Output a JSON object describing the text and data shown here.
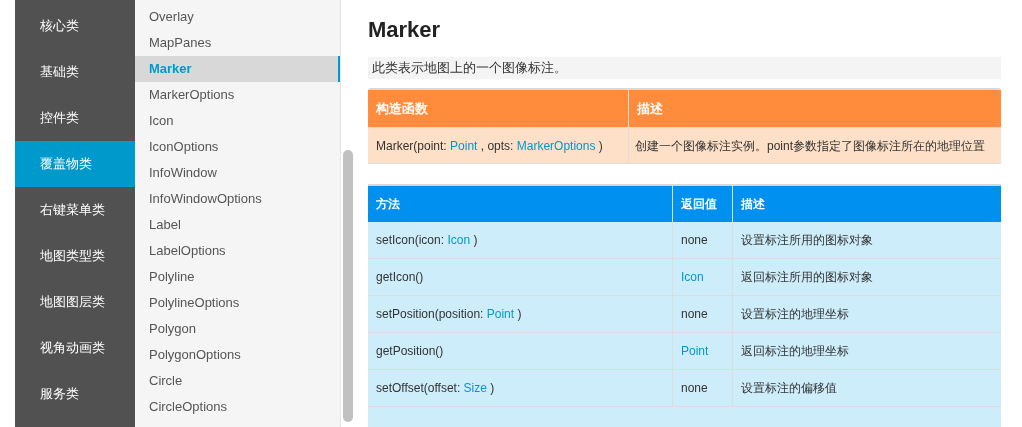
{
  "categories": [
    {
      "label": "核心类",
      "selected": false
    },
    {
      "label": "基础类",
      "selected": false
    },
    {
      "label": "控件类",
      "selected": false
    },
    {
      "label": "覆盖物类",
      "selected": true
    },
    {
      "label": "右键菜单类",
      "selected": false
    },
    {
      "label": "地图类型类",
      "selected": false
    },
    {
      "label": "地图图层类",
      "selected": false
    },
    {
      "label": "视角动画类",
      "selected": false
    },
    {
      "label": "服务类",
      "selected": false
    }
  ],
  "classes": [
    {
      "label": "Overlay",
      "selected": false
    },
    {
      "label": "MapPanes",
      "selected": false
    },
    {
      "label": "Marker",
      "selected": true
    },
    {
      "label": "MarkerOptions",
      "selected": false
    },
    {
      "label": "Icon",
      "selected": false
    },
    {
      "label": "IconOptions",
      "selected": false
    },
    {
      "label": "InfoWindow",
      "selected": false
    },
    {
      "label": "InfoWindowOptions",
      "selected": false
    },
    {
      "label": "Label",
      "selected": false
    },
    {
      "label": "LabelOptions",
      "selected": false
    },
    {
      "label": "Polyline",
      "selected": false
    },
    {
      "label": "PolylineOptions",
      "selected": false
    },
    {
      "label": "Polygon",
      "selected": false
    },
    {
      "label": "PolygonOptions",
      "selected": false
    },
    {
      "label": "Circle",
      "selected": false
    },
    {
      "label": "CircleOptions",
      "selected": false
    }
  ],
  "page": {
    "title": "Marker",
    "summary": "此类表示地图上的一个图像标注。"
  },
  "constructor_table": {
    "columns": [
      "构造函数",
      "描述"
    ],
    "rows": [
      {
        "signature": [
          {
            "kind": "code",
            "text": "Marker(point: "
          },
          {
            "kind": "link",
            "text": "Point"
          },
          {
            "kind": "code",
            "text": " , opts: "
          },
          {
            "kind": "link",
            "text": "MarkerOptions"
          },
          {
            "kind": "code",
            "text": " )"
          }
        ],
        "description": "创建一个图像标注实例。point参数指定了图像标注所在的地理位置"
      }
    ]
  },
  "method_table": {
    "columns": [
      "方法",
      "返回值",
      "描述"
    ],
    "rows": [
      {
        "method": [
          {
            "kind": "code",
            "text": "setIcon(icon: "
          },
          {
            "kind": "link",
            "text": "Icon"
          },
          {
            "kind": "code",
            "text": " )"
          }
        ],
        "returns": {
          "kind": "code",
          "text": "none"
        },
        "description": "设置标注所用的图标对象"
      },
      {
        "method": [
          {
            "kind": "code",
            "text": "getIcon()"
          }
        ],
        "returns": {
          "kind": "link",
          "text": "Icon"
        },
        "description": "返回标注所用的图标对象"
      },
      {
        "method": [
          {
            "kind": "code",
            "text": "setPosition(position: "
          },
          {
            "kind": "link",
            "text": "Point"
          },
          {
            "kind": "code",
            "text": " )"
          }
        ],
        "returns": {
          "kind": "code",
          "text": "none"
        },
        "description": "设置标注的地理坐标"
      },
      {
        "method": [
          {
            "kind": "code",
            "text": "getPosition()"
          }
        ],
        "returns": {
          "kind": "link",
          "text": "Point"
        },
        "description": "返回标注的地理坐标"
      },
      {
        "method": [
          {
            "kind": "code",
            "text": "setOffset(offset: "
          },
          {
            "kind": "link",
            "text": "Size"
          },
          {
            "kind": "code",
            "text": " )"
          }
        ],
        "returns": {
          "kind": "code",
          "text": "none"
        },
        "description": "设置标注的偏移值"
      }
    ]
  }
}
